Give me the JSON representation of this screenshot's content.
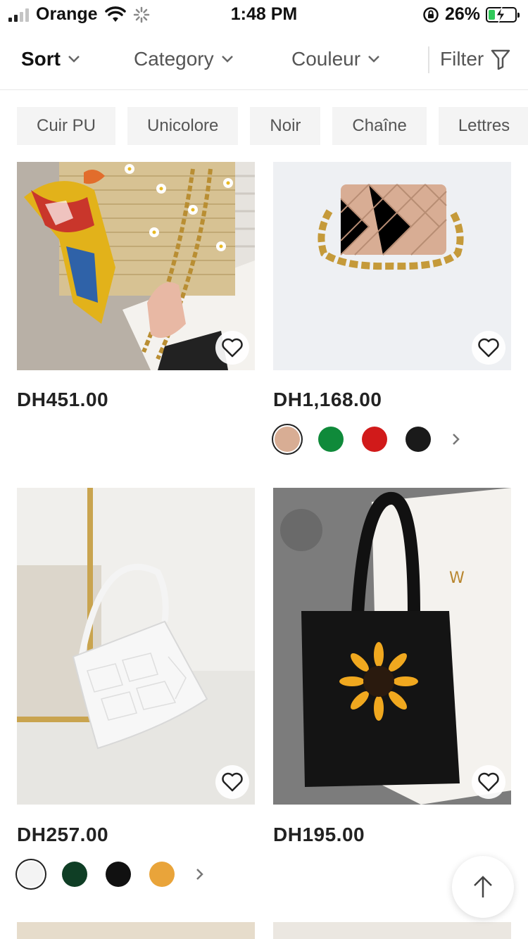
{
  "status_bar": {
    "carrier": "Orange",
    "time": "1:48 PM",
    "battery_percent": "26%",
    "battery_level": 0.26
  },
  "filter_bar": {
    "sort_label": "Sort",
    "category_label": "Category",
    "couleur_label": "Couleur",
    "filter_label": "Filter"
  },
  "chips": [
    "Cuir PU",
    "Unicolore",
    "Noir",
    "Chaîne",
    "Lettres"
  ],
  "products": [
    {
      "price": "DH451.00",
      "swatches": []
    },
    {
      "price": "DH1,168.00",
      "swatches": [
        "#d8ad94",
        "#0f8a3a",
        "#d11a1a",
        "#1a1a1a"
      ]
    },
    {
      "price": "DH257.00",
      "swatches": [
        "#f3f3f3",
        "#0f3e25",
        "#111111",
        "#e9a43a"
      ]
    },
    {
      "price": "DH195.00",
      "swatches": []
    }
  ],
  "icons": {
    "sort_chevron": "chevron-down-icon",
    "filter": "funnel-icon",
    "favorite": "heart-outline-icon",
    "more_colors": "chevron-right-icon",
    "scroll_top": "arrow-up-icon"
  }
}
